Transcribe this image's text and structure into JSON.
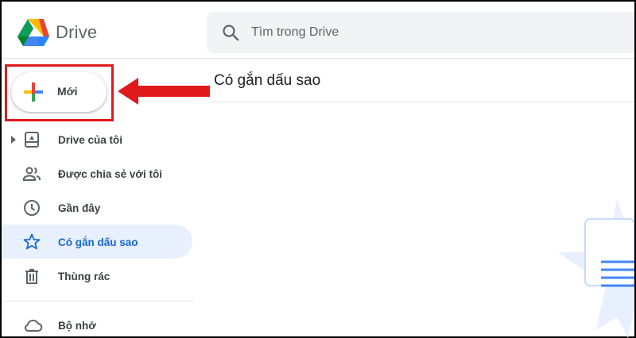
{
  "app": {
    "brand": "Drive"
  },
  "search": {
    "placeholder": "Tìm trong Drive",
    "value": ""
  },
  "new_button": {
    "label": "Mới"
  },
  "sidebar": {
    "items": [
      {
        "label": "Drive của tôi",
        "icon": "my-drive-icon",
        "expandable": true,
        "active": false
      },
      {
        "label": "Được chia sẻ với tôi",
        "icon": "shared-people-icon",
        "active": false
      },
      {
        "label": "Gần đây",
        "icon": "clock-icon",
        "active": false
      },
      {
        "label": "Có gắn dấu sao",
        "icon": "star-icon",
        "active": true
      },
      {
        "label": "Thùng rác",
        "icon": "trash-icon",
        "active": false
      }
    ],
    "storage": {
      "label": "Bộ nhớ",
      "icon": "cloud-icon"
    }
  },
  "main": {
    "title": "Có gắn dấu sao"
  },
  "colors": {
    "active_bg": "#e8f0fe",
    "active_text": "#1967d2",
    "annotation_red": "#e0191b",
    "search_bg": "#f1f3f4"
  }
}
